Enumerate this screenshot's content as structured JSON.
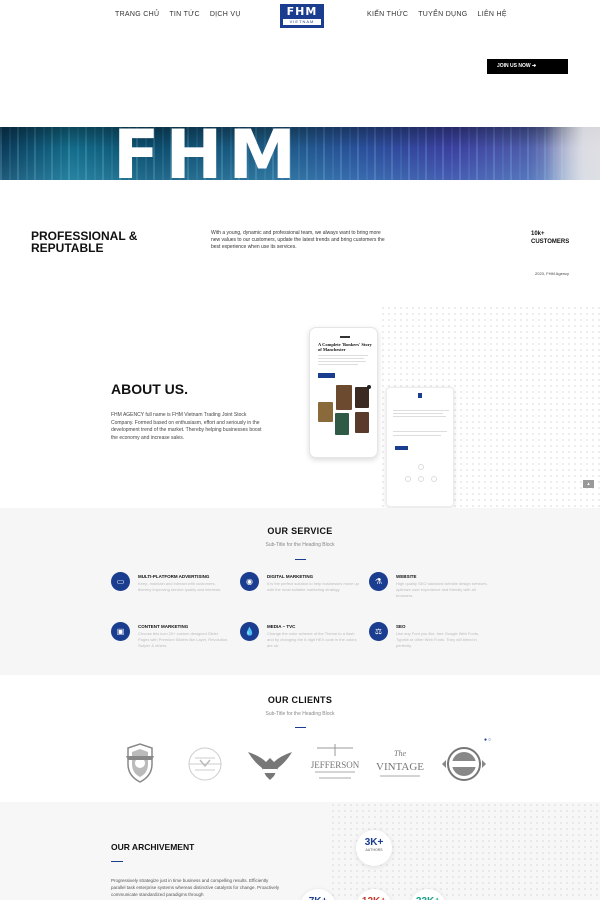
{
  "header": {
    "nav_left": [
      "TRANG CHỦ",
      "TIN TỨC",
      "DỊCH VỤ"
    ],
    "nav_right": [
      "KIẾN THỨC",
      "TUYỂN DỤNG",
      "LIÊN HỆ"
    ],
    "logo_main": "FHM",
    "logo_sub": "VIETNAM",
    "join_label": "JOIN US NOW ➔"
  },
  "hero": {
    "text": "FHM"
  },
  "professional": {
    "title": "PROFESSIONAL & REPUTABLE",
    "description": "With a young, dynamic and professional team, we always want to bring more new values to our customers, update the latest trends and bring customers the best experience when use its services.",
    "stat_value": "10k+",
    "stat_label": "CUSTOMERS",
    "caption": "2023, FHM Agency"
  },
  "about": {
    "title": "ABOUT US.",
    "description": "FHM AGENCY full name is FHM Vietnam Trading Joint Stock Company. Formed based on enthusiasm, effort and seriously in the development trend of the market. Thereby helping businesses boost the economy and increase sales.",
    "phone_heading": "A Complete 'Bonkers' Story of Manchester"
  },
  "service": {
    "title": "OUR SERVICE",
    "subtitle": "Sub-Title for the Heading Block",
    "items": [
      {
        "icon": "monitor-icon",
        "glyph": "▭",
        "title": "MULTI-PLATFORM ADVERTISING",
        "desc": "Keep, maintain and interact with customers, thereby improving service quality and interests."
      },
      {
        "icon": "eye-icon",
        "glyph": "◉",
        "title": "DIGITAL MARKETING",
        "desc": "It is the perfect solution to help businesses move up with the most suitable marketing strategy."
      },
      {
        "icon": "flask-icon",
        "glyph": "⚗",
        "title": "WEBSITE",
        "desc": "High quality SEO standard website design services, optimize user experience and friendly with all browsers."
      },
      {
        "icon": "window-icon",
        "glyph": "▣",
        "title": "CONTENT MARKETING",
        "desc": "Choose this icon 20+ custom designed Slider Pages with Premium Sliders like Layer, Revolution, Swiper & others."
      },
      {
        "icon": "drop-icon",
        "glyph": "💧",
        "title": "MEDIA – TVC",
        "desc": "Change the color scheme of the Theme to a flash and by changing the 6 digit HEX code in the colors are ok."
      },
      {
        "icon": "seo-icon",
        "glyph": "⚖",
        "title": "SEO",
        "desc": "Use any Font you like, free Google Web Fonts, Typekit or other Web Fonts. They will blend in perfectly."
      }
    ]
  },
  "clients": {
    "title": "OUR CLIENTS",
    "subtitle": "Sub-Title for the Heading Block",
    "logos": [
      {
        "name": "client-logo-shield",
        "text": ""
      },
      {
        "name": "client-logo-circle",
        "text": ""
      },
      {
        "name": "client-logo-eagle",
        "text": ""
      },
      {
        "name": "client-logo-jefferson",
        "text": "JEFFERSON"
      },
      {
        "name": "client-logo-vintage",
        "text": "VINTAGE",
        "pre": "The"
      },
      {
        "name": "client-logo-badge",
        "text": ""
      }
    ]
  },
  "achievement": {
    "title": "OUR ARCHIVEMENT",
    "description": "Progressively strategize just in time business and compelling results. Efficiently parallel task enterprise systems whereas distinctive catalysts for change. Proactively communicate standardized paradigms through",
    "stats": [
      {
        "value": "3K+",
        "label": "AUTHORS"
      },
      {
        "value": "7K+",
        "label": ""
      },
      {
        "value": "12K+",
        "label": ""
      },
      {
        "value": "23K+",
        "label": ""
      }
    ]
  },
  "colors": {
    "brand": "#1a3d8f",
    "dark": "#111111"
  }
}
